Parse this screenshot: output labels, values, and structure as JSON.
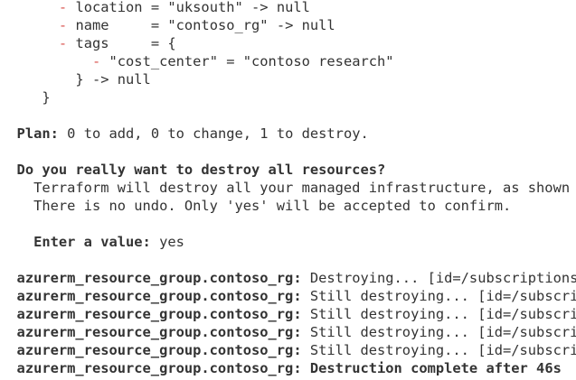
{
  "terminal": {
    "diff": {
      "minus": "-",
      "location_line": "location = \"uksouth\" -> null",
      "name_line": "name     = \"contoso_rg\" -> null",
      "tags_line": "tags     = {",
      "cost_center_line": "\"cost_center\" = \"contoso research\"",
      "tags_close": "} -> null",
      "block_close": "}"
    },
    "plan": {
      "label": "Plan:",
      "text": "0 to add, 0 to change, 1 to destroy."
    },
    "prompt": {
      "question": "Do you really want to destroy all resources?",
      "warning_1": "Terraform will destroy all your managed infrastructure, as shown a",
      "warning_2": "There is no undo. Only 'yes' will be accepted to confirm.",
      "enter_label": "Enter a value:",
      "entered_value": "yes"
    },
    "progress": [
      {
        "resource": "azurerm_resource_group.contoso_rg:",
        "message": "Destroying... [id=/subscriptions/"
      },
      {
        "resource": "azurerm_resource_group.contoso_rg:",
        "message": "Still destroying... [id=/subscrip"
      },
      {
        "resource": "azurerm_resource_group.contoso_rg:",
        "message": "Still destroying... [id=/subscrip"
      },
      {
        "resource": "azurerm_resource_group.contoso_rg:",
        "message": "Still destroying... [id=/subscrip"
      },
      {
        "resource": "azurerm_resource_group.contoso_rg:",
        "message": "Still destroying... [id=/subscrip"
      },
      {
        "resource": "azurerm_resource_group.contoso_rg:",
        "message": "Destruction complete after 46s"
      }
    ],
    "colors": {
      "background": "#ffffff",
      "text": "#333333",
      "minus": "#d9534f"
    }
  }
}
